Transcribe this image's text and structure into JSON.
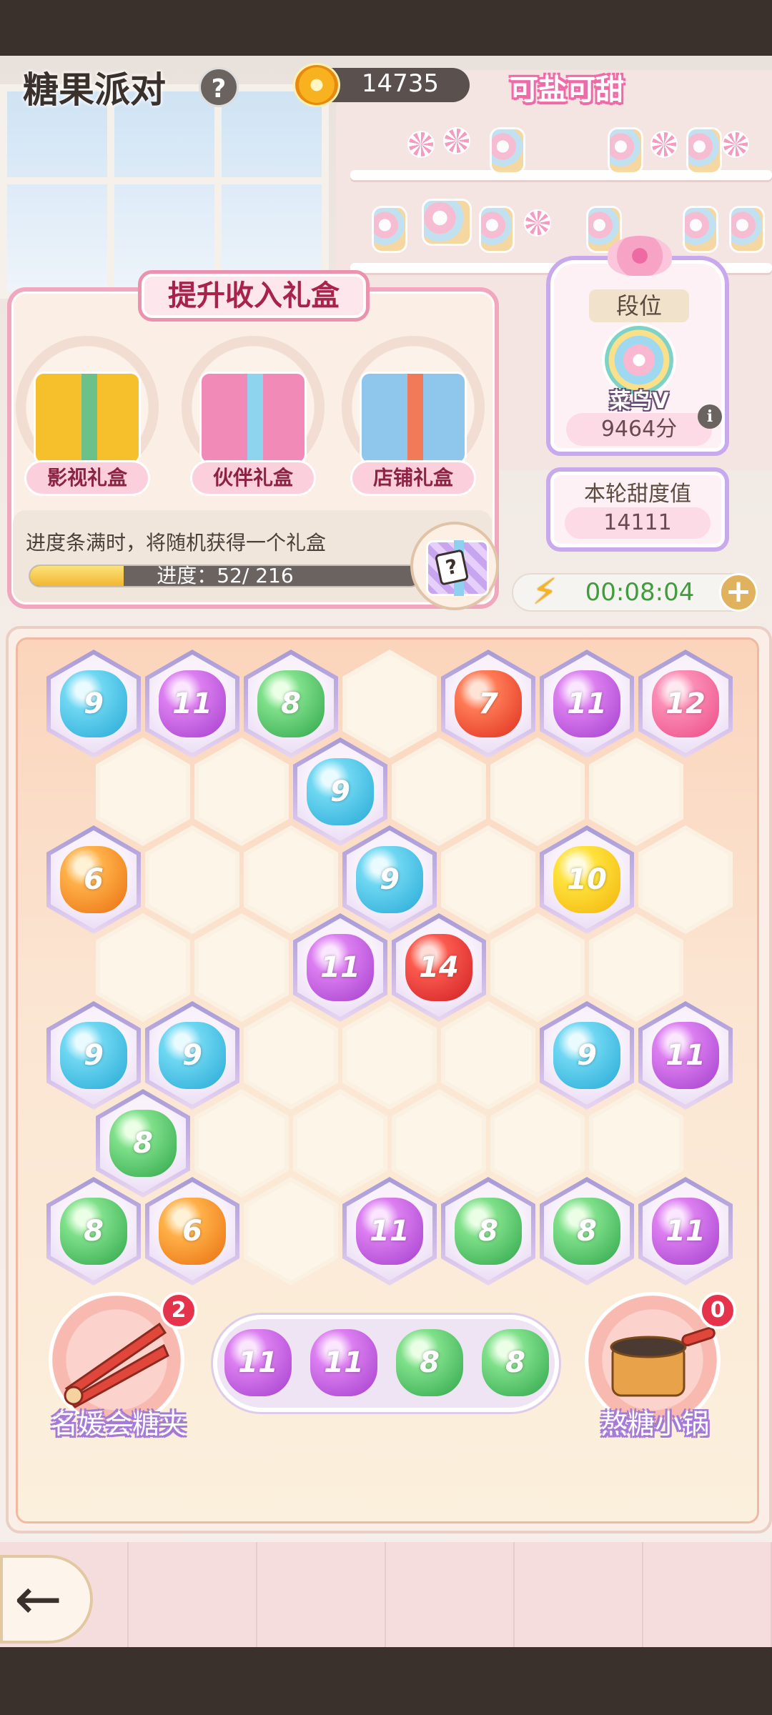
{
  "header": {
    "title": "糖果派对",
    "help_symbol": "?",
    "coins": "14735",
    "logo_text": "可盐可甜"
  },
  "gift_panel": {
    "title": "提升收入礼盒",
    "boxes": [
      {
        "label": "影视礼盒",
        "color": "#f6c02c"
      },
      {
        "label": "伙伴礼盒",
        "color": "#f28ab8"
      },
      {
        "label": "店铺礼盒",
        "color": "#8fc7ec"
      }
    ],
    "note": "进度条满时，将随机获得一个礼盒",
    "progress_text": "进度：52/ 216",
    "progress_current": 52,
    "progress_total": 216,
    "mystery_symbol": "?"
  },
  "rank": {
    "title": "段位",
    "name": "菜鸟V",
    "score": "9464分",
    "info_symbol": "i"
  },
  "sweetness": {
    "label": "本轮甜度值",
    "value": "14111"
  },
  "energy": {
    "timer": "00:08:04",
    "plus_symbol": "+"
  },
  "board": {
    "rows": [
      [
        {
          "v": "9",
          "c": "cyan"
        },
        {
          "v": "11",
          "c": "purple"
        },
        {
          "v": "8",
          "c": "green"
        },
        null,
        {
          "v": "7",
          "c": "red"
        },
        {
          "v": "11",
          "c": "purple"
        },
        {
          "v": "12",
          "c": "pink"
        }
      ],
      [
        null,
        null,
        {
          "v": "9",
          "c": "cyan"
        },
        null,
        null,
        null
      ],
      [
        {
          "v": "6",
          "c": "orange"
        },
        null,
        null,
        {
          "v": "9",
          "c": "cyan"
        },
        null,
        {
          "v": "10",
          "c": "yellow"
        },
        null
      ],
      [
        null,
        null,
        {
          "v": "11",
          "c": "purple"
        },
        {
          "v": "14",
          "c": "crimson"
        },
        null,
        null
      ],
      [
        {
          "v": "9",
          "c": "cyan"
        },
        {
          "v": "9",
          "c": "cyan"
        },
        null,
        null,
        null,
        {
          "v": "9",
          "c": "cyan"
        },
        {
          "v": "11",
          "c": "purple"
        }
      ],
      [
        {
          "v": "8",
          "c": "green"
        },
        null,
        null,
        null,
        null,
        null
      ],
      [
        {
          "v": "8",
          "c": "green"
        },
        {
          "v": "6",
          "c": "orange"
        },
        null,
        {
          "v": "11",
          "c": "purple"
        },
        {
          "v": "8",
          "c": "green"
        },
        {
          "v": "8",
          "c": "green"
        },
        {
          "v": "11",
          "c": "purple"
        }
      ]
    ]
  },
  "tools": {
    "tongs": {
      "label": "名媛会糖夹",
      "count": "2"
    },
    "pot": {
      "label": "熬糖小锅",
      "count": "0"
    }
  },
  "tray": [
    {
      "v": "11",
      "c": "purple"
    },
    {
      "v": "11",
      "c": "purple"
    },
    {
      "v": "8",
      "c": "green"
    },
    {
      "v": "8",
      "c": "green"
    }
  ],
  "nav": {
    "back_symbol": "←"
  }
}
